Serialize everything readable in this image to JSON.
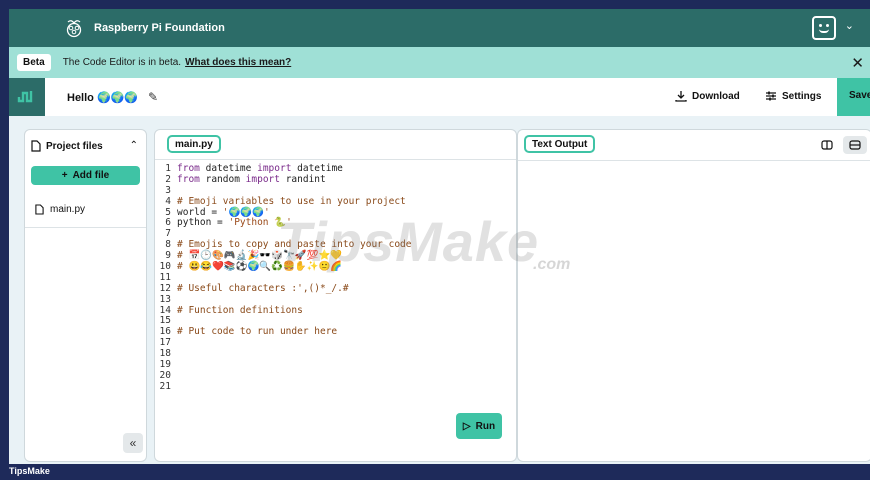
{
  "topbar": {
    "title": "Raspberry Pi Foundation"
  },
  "banner": {
    "badge": "Beta",
    "text": "The Code Editor is in beta.",
    "link": "What does this mean?"
  },
  "project": {
    "name": "Hello 🌍🌍🌍",
    "download_label": "Download",
    "settings_label": "Settings",
    "save_label": "Save"
  },
  "sidebar": {
    "title": "Project files",
    "add_file_label": "Add file",
    "files": [
      "main.py"
    ]
  },
  "editor": {
    "tab_label": "main.py",
    "run_label": "Run",
    "lines": [
      [
        [
          "kw",
          "from"
        ],
        [
          "plain",
          " datetime "
        ],
        [
          "kw",
          "import"
        ],
        [
          "plain",
          " datetime"
        ]
      ],
      [
        [
          "kw",
          "from"
        ],
        [
          "plain",
          " random "
        ],
        [
          "kw",
          "import"
        ],
        [
          "plain",
          " randint"
        ]
      ],
      [],
      [
        [
          "cmt",
          "# Emoji variables to use in your project"
        ]
      ],
      [
        [
          "plain",
          "world = "
        ],
        [
          "str",
          "'🌍🌍🌍'"
        ]
      ],
      [
        [
          "plain",
          "python = "
        ],
        [
          "str",
          "'Python 🐍'"
        ]
      ],
      [],
      [
        [
          "cmt",
          "# Emojis to copy and paste into your code"
        ]
      ],
      [
        [
          "cmt",
          "# 📅🕒🎨🎮🔬🎉🕶️🎲🔭🚀💯⭐💛"
        ]
      ],
      [
        [
          "cmt",
          "# 😃😂❤️📚⚽🌍🔍♻️🍔✋✨🙂🌈"
        ]
      ],
      [],
      [
        [
          "cmt",
          "# Useful characters :',()*_/.#"
        ]
      ],
      [],
      [
        [
          "cmt",
          "# Function definitions"
        ]
      ],
      [],
      [
        [
          "cmt",
          "# Put code to run under here"
        ]
      ],
      [],
      [],
      [],
      [],
      []
    ]
  },
  "output": {
    "tab_label": "Text Output"
  },
  "watermark": {
    "text": "TipsMake",
    "suffix": ".com"
  },
  "footer": {
    "brand": "TipsMake"
  },
  "colors": {
    "topbar": "#2c6c68",
    "accent": "#3fc3a5",
    "banner": "#9fe0d6"
  }
}
